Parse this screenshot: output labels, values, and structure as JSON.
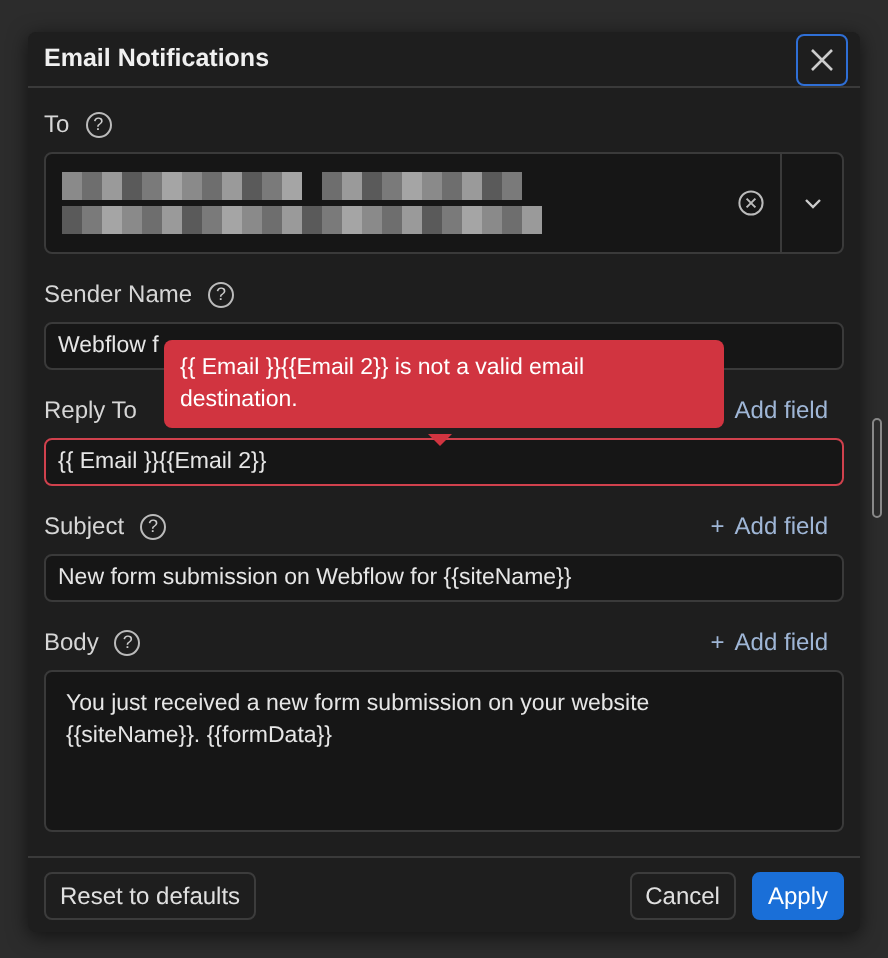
{
  "dialog": {
    "title": "Email Notifications",
    "close_focused": true
  },
  "fields": [
    {
      "kind": "multiselect",
      "label": "To",
      "help": "?",
      "redacted": true
    },
    {
      "kind": "text",
      "label": "Sender Name",
      "help": "?",
      "value": "Webflow f",
      "invalid": false
    },
    {
      "kind": "text",
      "label": "Reply To",
      "add_field": {
        "label": "Add field"
      },
      "value": "{{ Email }}{{Email 2}}",
      "invalid": true
    },
    {
      "kind": "text",
      "label": "Subject",
      "help": "?",
      "add_field": {
        "icon": "+",
        "label": "Add field"
      },
      "value": "New form submission on Webflow for {{siteName}}",
      "invalid": false
    },
    {
      "kind": "textarea",
      "label": "Body",
      "help": "?",
      "add_field": {
        "icon": "+",
        "label": "Add field"
      },
      "value": "You just received a new form submission on your website {{siteName}}. {{formData}}",
      "invalid": false
    }
  ],
  "tooltip": {
    "text": "{{ Email }}{{Email 2}} is not a valid email destination."
  },
  "footer": {
    "buttons": [
      {
        "label": "Reset to defaults",
        "kind": "secondary"
      },
      {
        "label": "Cancel",
        "kind": "secondary"
      },
      {
        "label": "Apply",
        "kind": "primary"
      }
    ]
  }
}
